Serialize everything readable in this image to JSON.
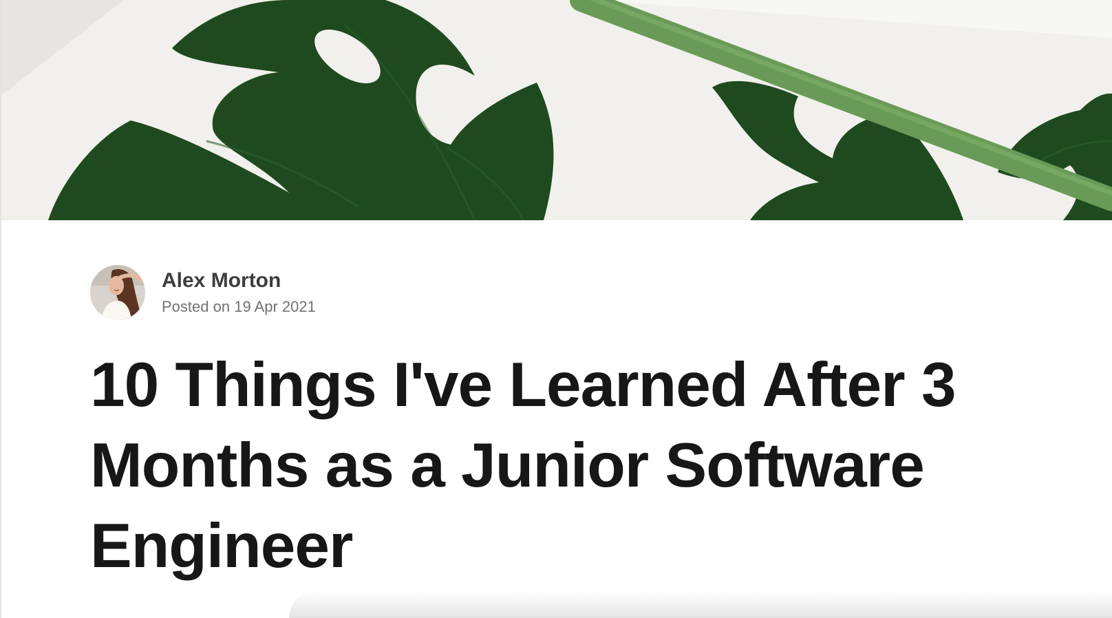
{
  "cover": {
    "image": "monstera-leaves-cover-image"
  },
  "author": {
    "name": "Alex Morton",
    "avatar": "author-avatar"
  },
  "post": {
    "posted_prefix": "Posted on",
    "date": "19 Apr 2021",
    "title": "10 Things I've Learned After 3 Months as a Junior Software Engineer"
  },
  "colors": {
    "cover_background": "#f1f0ec",
    "leaf_dark": "#1f4a1f",
    "stem_green": "#6a9a57",
    "title_text": "#171717",
    "author_text": "#3d3d3d",
    "meta_text": "#717171"
  }
}
